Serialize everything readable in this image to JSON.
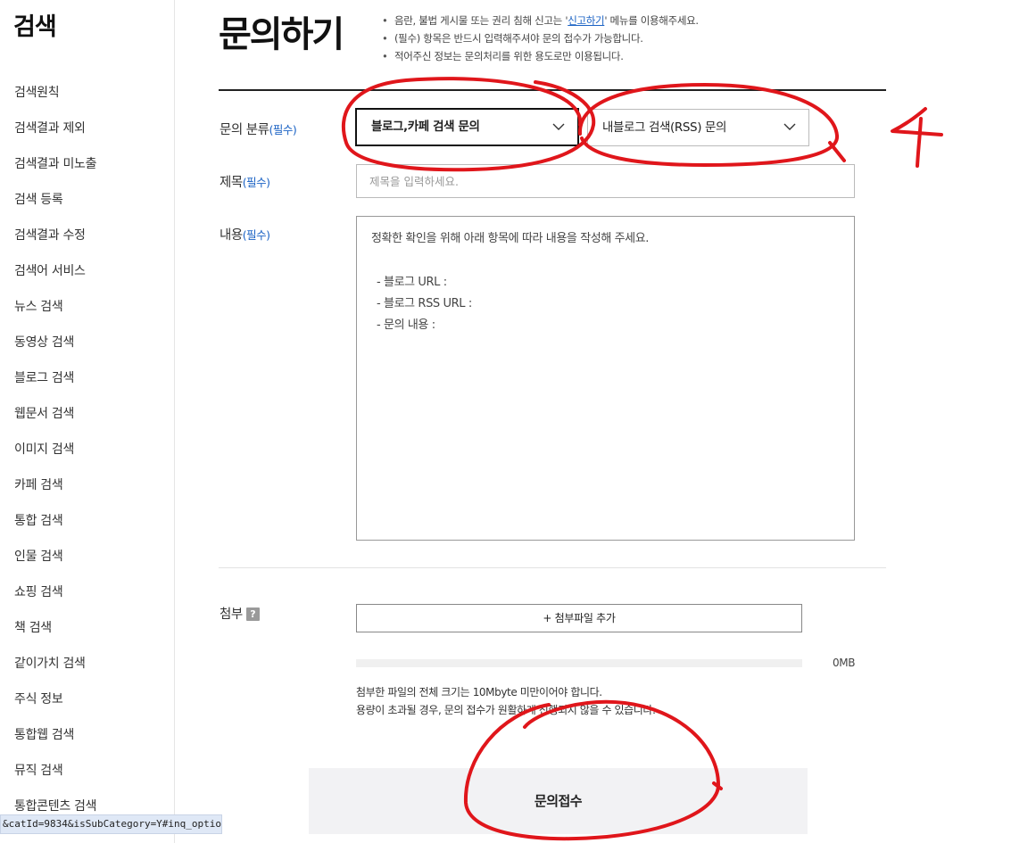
{
  "sidebar": {
    "title": "검색",
    "items": [
      {
        "label": "검색원칙"
      },
      {
        "label": "검색결과 제외"
      },
      {
        "label": "검색결과 미노출"
      },
      {
        "label": "검색 등록"
      },
      {
        "label": "검색결과 수정"
      },
      {
        "label": "검색어 서비스"
      },
      {
        "label": "뉴스 검색"
      },
      {
        "label": "동영상 검색"
      },
      {
        "label": "블로그 검색"
      },
      {
        "label": "웹문서 검색"
      },
      {
        "label": "이미지 검색"
      },
      {
        "label": "카페 검색"
      },
      {
        "label": "통합 검색"
      },
      {
        "label": "인물 검색"
      },
      {
        "label": "쇼핑 검색"
      },
      {
        "label": "책 검색"
      },
      {
        "label": "같이가치 검색"
      },
      {
        "label": "주식 정보"
      },
      {
        "label": "통합웹 검색"
      },
      {
        "label": "뮤직 검색"
      },
      {
        "label": "통합콘텐츠 검색"
      }
    ]
  },
  "status_bar": {
    "url": "&catId=9834&isSubCategory=Y#inq_optio..."
  },
  "header": {
    "title": "문의하기",
    "notices": {
      "n1_before": "음란, 불법 게시물 또는 권리 침해 신고는 '",
      "n1_link": "신고하기",
      "n1_after": "' 메뉴를 이용해주세요.",
      "n2": "(필수) 항목은 반드시 입력해주셔야 문의 접수가 가능합니다.",
      "n3": "적어주신 정보는 문의처리를 위한 용도로만 이용됩니다."
    }
  },
  "form": {
    "required_mark": "(필수)",
    "category": {
      "label": "문의 분류",
      "primary_value": "블로그,카페 검색 문의",
      "secondary_value": "내블로그 검색(RSS) 문의"
    },
    "subject": {
      "label": "제목",
      "placeholder": "제목을 입력하세요."
    },
    "content": {
      "label": "내용",
      "intro": "정확한 확인을 위해 아래 항목에 따라 내용을 작성해 주세요.",
      "lines": [
        "- 블로그 URL :",
        "- 블로그 RSS URL :",
        "- 문의 내용 :"
      ]
    },
    "attachment": {
      "label": "첨부",
      "help_glyph": "?",
      "add_button": "+ 첨부파일 추가",
      "used_fraction": 0,
      "size_text": "0MB",
      "note_line1": "첨부한 파일의 전체 크기는 10Mbyte 미만이어야 합니다.",
      "note_line2": "용량이 초과될 경우, 문의 접수가 원활하게 진행되지 않을 수 있습니다."
    },
    "submit_label": "문의접수"
  },
  "annotations": {
    "color": "#e0161b",
    "number_mark": "4"
  }
}
